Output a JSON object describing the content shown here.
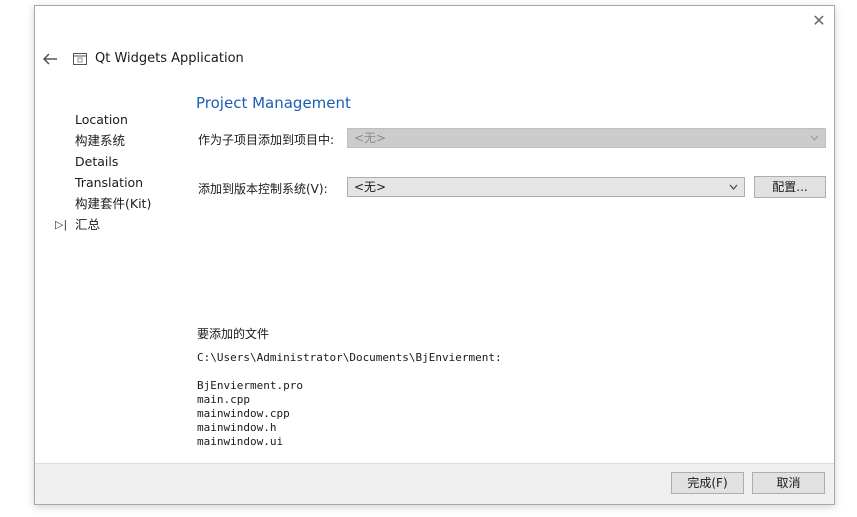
{
  "window": {
    "title": "Qt Widgets Application",
    "close_glyph": "✕"
  },
  "nav": {
    "items": [
      {
        "label": "Location"
      },
      {
        "label": "构建系统"
      },
      {
        "label": "Details"
      },
      {
        "label": "Translation"
      },
      {
        "label": "构建套件(Kit)"
      },
      {
        "label": "汇总",
        "current": true
      }
    ],
    "current_marker": "▷|"
  },
  "page": {
    "section_title": "Project Management",
    "add_as_subproject": {
      "label": "作为子项目添加到项目中:",
      "value": "<无>",
      "enabled": false
    },
    "add_to_vcs": {
      "label": "添加到版本控制系统(V):",
      "value": "<无>",
      "configure_button": "配置..."
    },
    "files": {
      "label": "要添加的文件",
      "directory": "C:\\Users\\Administrator\\Documents\\BjEnvierment:",
      "list": [
        "BjEnvierment.pro",
        "main.cpp",
        "mainwindow.cpp",
        "mainwindow.h",
        "mainwindow.ui"
      ]
    }
  },
  "footer": {
    "finish_button": "完成(F)",
    "cancel_button": "取消"
  },
  "colors": {
    "accent": "#1c5cb5",
    "footer_bg": "#f0f0f0",
    "button_bg": "#e1e1e1"
  },
  "icons": [
    "close-icon",
    "back-arrow-icon",
    "application-icon",
    "chevron-down-icon"
  ]
}
